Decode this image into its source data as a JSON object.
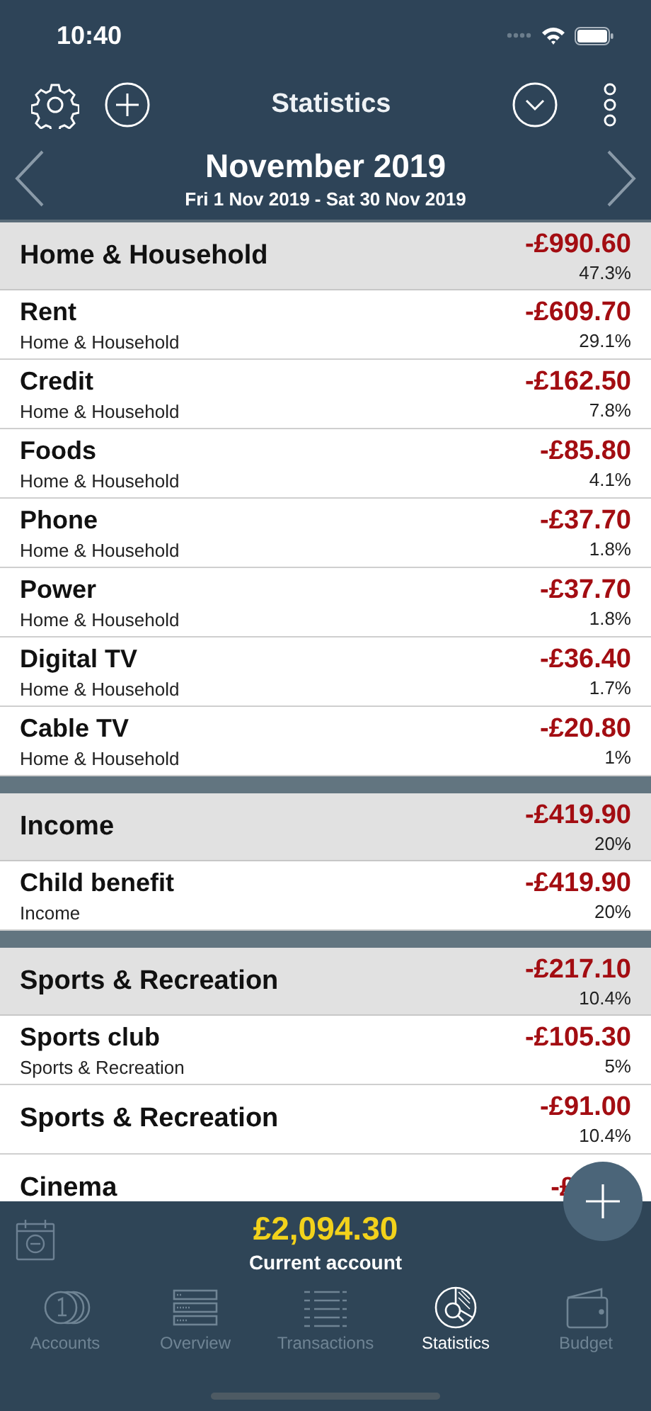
{
  "status_bar": {
    "time": "10:40"
  },
  "toolbar": {
    "title": "Statistics"
  },
  "period": {
    "title": "November 2019",
    "range": "Fri 1 Nov 2019 - Sat 30 Nov 2019"
  },
  "groups": [
    {
      "name": "Home & Household",
      "amount": "-£990.60",
      "percent": "47.3%",
      "rows": [
        {
          "name": "Rent",
          "category": "Home & Household",
          "amount": "-£609.70",
          "percent": "29.1%"
        },
        {
          "name": "Credit",
          "category": "Home & Household",
          "amount": "-£162.50",
          "percent": "7.8%"
        },
        {
          "name": "Foods",
          "category": "Home & Household",
          "amount": "-£85.80",
          "percent": "4.1%"
        },
        {
          "name": "Phone",
          "category": "Home & Household",
          "amount": "-£37.70",
          "percent": "1.8%"
        },
        {
          "name": "Power",
          "category": "Home & Household",
          "amount": "-£37.70",
          "percent": "1.8%"
        },
        {
          "name": "Digital TV",
          "category": "Home & Household",
          "amount": "-£36.40",
          "percent": "1.7%"
        },
        {
          "name": "Cable TV",
          "category": "Home & Household",
          "amount": "-£20.80",
          "percent": "1%"
        }
      ]
    },
    {
      "name": "Income",
      "amount": "-£419.90",
      "percent": "20%",
      "rows": [
        {
          "name": "Child benefit",
          "category": "Income",
          "amount": "-£419.90",
          "percent": "20%"
        }
      ]
    },
    {
      "name": "Sports & Recreation",
      "amount": "-£217.10",
      "percent": "10.4%",
      "rows": [
        {
          "name": "Sports club",
          "category": "Sports & Recreation",
          "amount": "-£105.30",
          "percent": "5%"
        },
        {
          "name": "Sports & Recreation",
          "amount": "-£91.00",
          "percent": "10.4%"
        },
        {
          "name": "Cinema",
          "amount": "-£"
        }
      ]
    }
  ],
  "balance": {
    "amount": "£2,094.30",
    "account": "Current account"
  },
  "tabs": [
    {
      "label": "Accounts",
      "selected": false
    },
    {
      "label": "Overview",
      "selected": false
    },
    {
      "label": "Transactions",
      "selected": false
    },
    {
      "label": "Statistics",
      "selected": true
    },
    {
      "label": "Budget",
      "selected": false
    }
  ]
}
